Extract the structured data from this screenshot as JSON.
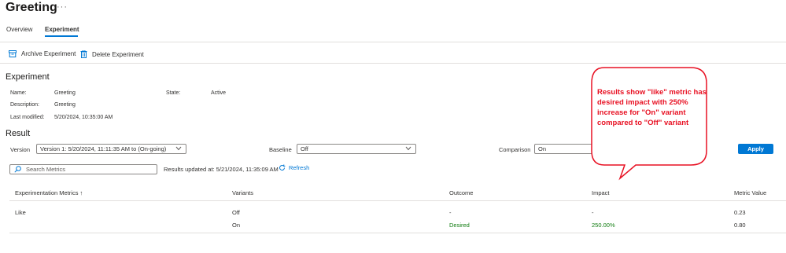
{
  "header": {
    "title": "Greeting",
    "more_label": "···"
  },
  "tabs": [
    {
      "label": "Overview",
      "active": false
    },
    {
      "label": "Experiment",
      "active": true
    }
  ],
  "commands": {
    "archive_label": "Archive Experiment",
    "delete_label": "Delete Experiment"
  },
  "experiment": {
    "section_title": "Experiment",
    "name_label": "Name:",
    "name_value": "Greeting",
    "description_label": "Description:",
    "description_value": "Greeting",
    "modified_label": "Last modified:",
    "modified_value": "5/20/2024, 10:35:00 AM",
    "state_label": "State:",
    "state_value": "Active"
  },
  "result": {
    "section_title": "Result",
    "version_label": "Version",
    "version_value": "Version 1: 5/20/2024, 11:11:35 AM to (On-going)",
    "baseline_label": "Baseline",
    "baseline_value": "Off",
    "comparison_label": "Comparison",
    "comparison_value": "On",
    "apply_label": "Apply",
    "search_placeholder": "Search Metrics",
    "updated_text": "Results updated at: 5/21/2024, 11:35:09 AM",
    "refresh_label": "Refresh"
  },
  "table": {
    "headers": {
      "metrics": "Experimentation Metrics ↑",
      "variants": "Variants",
      "outcome": "Outcome",
      "impact": "Impact",
      "value": "Metric Value"
    },
    "rows": [
      {
        "metric": "Like",
        "variant": "Off",
        "outcome": "-",
        "impact": "-",
        "value": "0.23"
      },
      {
        "metric": "",
        "variant": "On",
        "outcome": "Desired",
        "impact": "250.00%",
        "value": "0.80"
      }
    ]
  },
  "callout": {
    "text": "Results show \"like\" metric has desired impact with 250% increase for \"On\" variant compared to \"Off\" variant"
  },
  "colors": {
    "accent": "#0078d4",
    "positive": "#107c10",
    "annotation": "#e81123"
  }
}
